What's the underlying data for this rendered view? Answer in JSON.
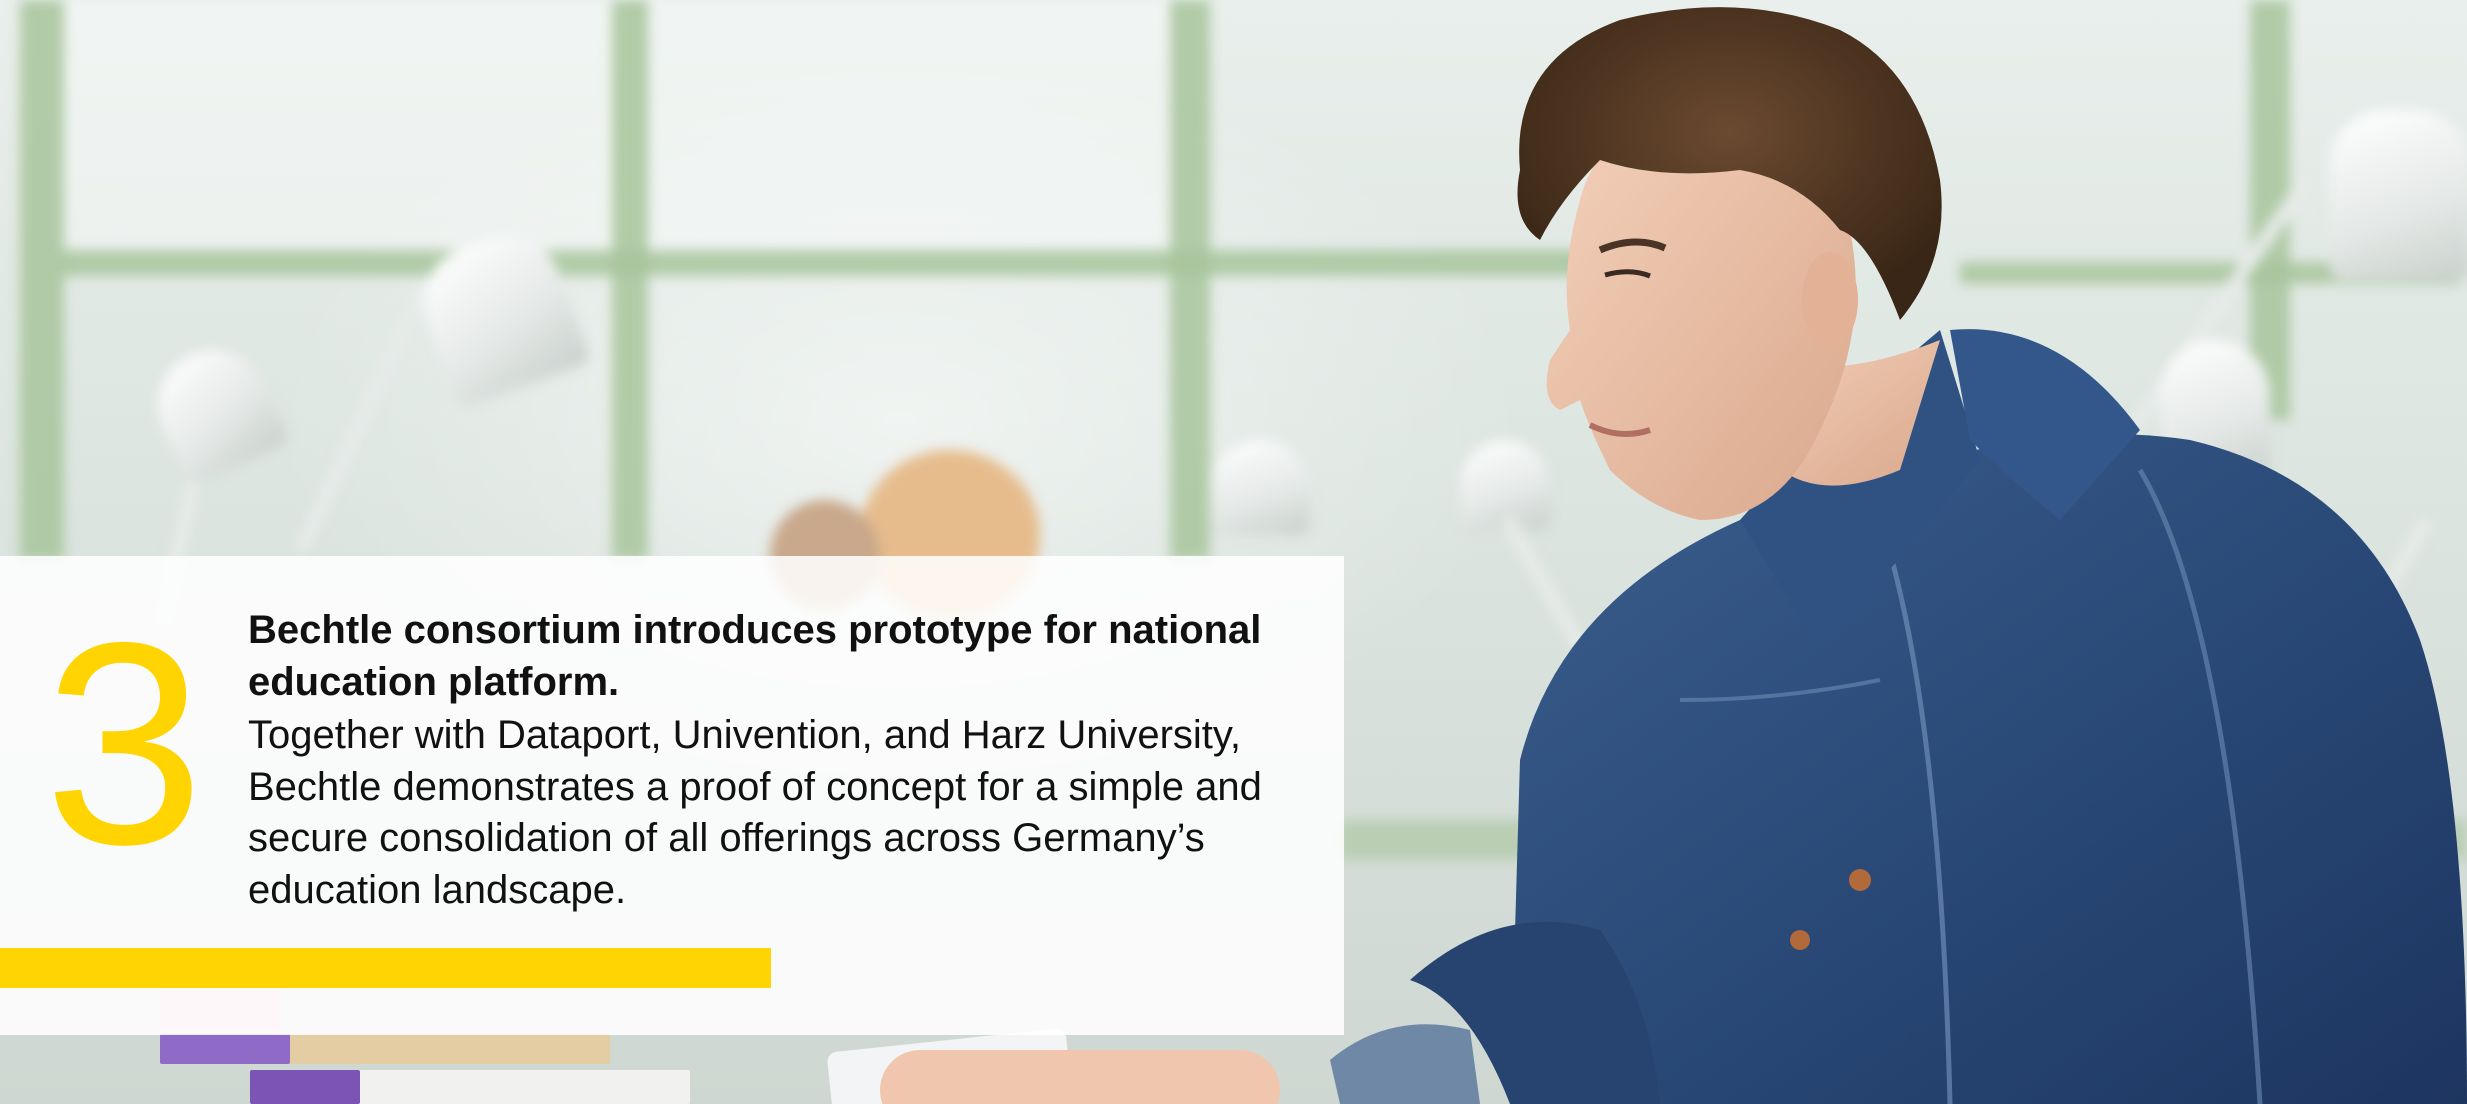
{
  "slide": {
    "number": "3",
    "headline": "Bechtle consortium introduces prototype for national education platform.",
    "body": "Together with Dataport, Univention, and Harz University, Bechtle demonstrates a proof of concept for a simple and secure consolidation of all offerings across Germany’s education landscape."
  },
  "colors": {
    "accent": "#ffd400",
    "text": "#111111",
    "card": "#ffffff"
  }
}
